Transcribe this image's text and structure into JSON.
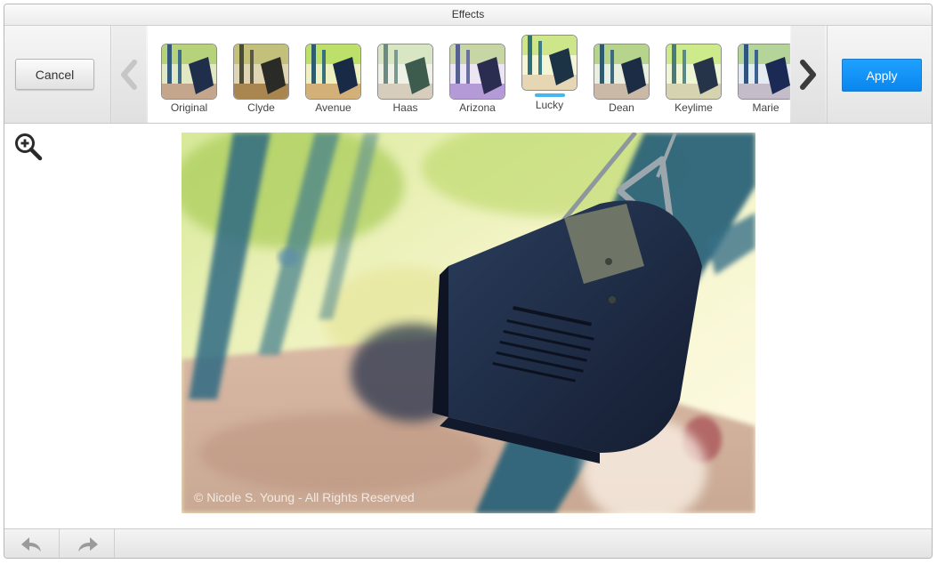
{
  "window": {
    "title": "Effects"
  },
  "toolbar": {
    "cancel_label": "Cancel",
    "apply_label": "Apply",
    "prev_icon": "chevron-left-icon",
    "next_icon": "chevron-right-icon",
    "selected_effect": "Lucky",
    "effects": [
      {
        "label": "Original"
      },
      {
        "label": "Clyde"
      },
      {
        "label": "Avenue"
      },
      {
        "label": "Haas"
      },
      {
        "label": "Arizona"
      },
      {
        "label": "Lucky"
      },
      {
        "label": "Dean"
      },
      {
        "label": "Keylime"
      },
      {
        "label": "Marie"
      }
    ]
  },
  "canvas": {
    "zoom_icon": "zoom-in-icon",
    "photo_credit": "© Nicole S. Young - All Rights Reserved"
  },
  "footer": {
    "undo_icon": "undo-icon",
    "redo_icon": "redo-icon"
  },
  "colors": {
    "apply_button": "#0a8ff5",
    "selection_indicator": "#47b6f0"
  }
}
